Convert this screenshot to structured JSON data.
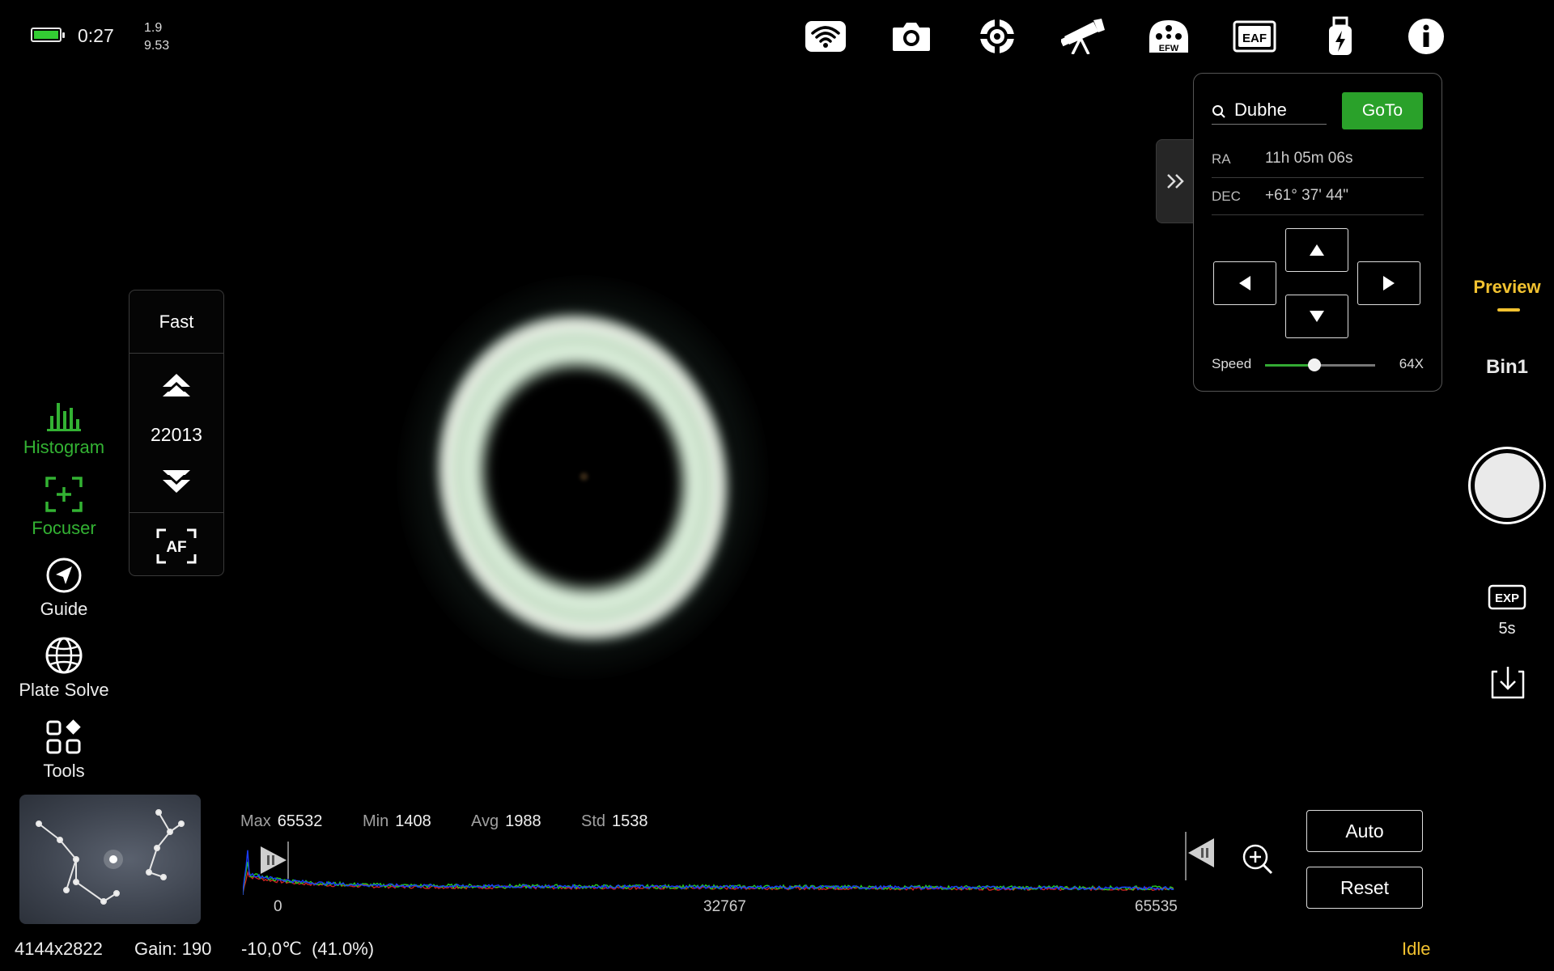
{
  "status": {
    "battery_level": 1.0,
    "time": "0:27",
    "value_top": "1.9",
    "value_bottom": "9.53"
  },
  "top_icons": [
    "wifi-icon",
    "camera-icon",
    "mount-target-icon",
    "telescope-icon",
    "filter-wheel-icon",
    "focuser-eaf-icon",
    "usb-drive-icon",
    "info-icon"
  ],
  "top_labels": {
    "efw": "EFW",
    "eaf": "EAF"
  },
  "left_tools": [
    {
      "label": "Histogram",
      "icon": "histogram-icon",
      "active": true
    },
    {
      "label": "Focuser",
      "icon": "focuser-icon",
      "active": true
    },
    {
      "label": "Guide",
      "icon": "guide-icon",
      "active": false
    },
    {
      "label": "Plate Solve",
      "icon": "globe-icon",
      "active": false
    },
    {
      "label": "Tools",
      "icon": "tools-grid-icon",
      "active": false
    }
  ],
  "focuser": {
    "mode": "Fast",
    "position": "22013",
    "af_label": "AF"
  },
  "goto": {
    "search_value": "Dubhe",
    "goto_label": "GoTo",
    "ra_label": "RA",
    "ra_value": "11h 05m 06s",
    "dec_label": "DEC",
    "dec_value": "+61° 37' 44\"",
    "speed_label": "Speed",
    "speed_value": "64X",
    "speed_fraction": 0.45,
    "collapse_icon": "double-chevron-right-icon"
  },
  "right": {
    "mode": "Preview",
    "bin": "Bin1",
    "exp_label": "EXP",
    "exposure": "5s",
    "download_icon": "download-icon"
  },
  "histogram": {
    "max_label": "Max",
    "max": "65532",
    "min_label": "Min",
    "min": "1408",
    "avg_label": "Avg",
    "avg": "1988",
    "std_label": "Std",
    "std": "1538",
    "tick_left": "0",
    "tick_mid": "32767",
    "tick_right": "65535",
    "auto_label": "Auto",
    "reset_label": "Reset",
    "colors": {
      "blue": "#1a3cff",
      "green": "#22cc22",
      "red": "#cc2222"
    }
  },
  "bottom": {
    "resolution": "4144x2822",
    "gain": "Gain: 190",
    "temperature": "-10,0℃  (41.0%)",
    "state": "Idle"
  }
}
